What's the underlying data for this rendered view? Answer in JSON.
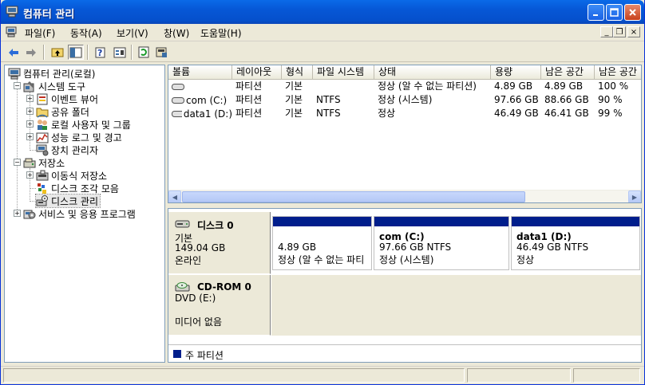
{
  "window": {
    "title": "컴퓨터 관리"
  },
  "menu": {
    "items": [
      "파일(F)",
      "동작(A)",
      "보기(V)",
      "창(W)",
      "도움말(H)"
    ],
    "mdi_min": "_",
    "mdi_restore": "❐",
    "mdi_close": "×"
  },
  "tree": {
    "root": "컴퓨터 관리(로컬)",
    "system_tools": "시스템 도구",
    "event_viewer": "이벤트 뷰어",
    "shared_folders": "공유 폴더",
    "local_users": "로컬 사용자 및 그룹",
    "perf_logs": "성능 로그 및 경고",
    "device_manager": "장치 관리자",
    "storage": "저장소",
    "removable": "이동식 저장소",
    "defrag": "디스크 조각 모음",
    "disk_mgmt": "디스크 관리",
    "services": "서비스 및 응용 프로그램"
  },
  "volumes": {
    "headers": [
      "볼륨",
      "레이아웃",
      "형식",
      "파일 시스템",
      "상태",
      "용량",
      "남은 공간",
      "남은 공간"
    ],
    "rows": [
      [
        "",
        "파티션",
        "기본",
        "",
        "정상 (알 수 없는 파티션)",
        "4.89 GB",
        "4.89 GB",
        "100 %"
      ],
      [
        "com (C:)",
        "파티션",
        "기본",
        "NTFS",
        "정상 (시스템)",
        "97.66 GB",
        "88.66 GB",
        "90 %"
      ],
      [
        "data1 (D:)",
        "파티션",
        "기본",
        "NTFS",
        "정상",
        "46.49 GB",
        "46.41 GB",
        "99 %"
      ]
    ]
  },
  "disks": {
    "disk0": {
      "name": "디스크 0",
      "type": "기본",
      "size": "149.04 GB",
      "status": "온라인",
      "partitions": [
        {
          "name": "",
          "size": "4.89 GB",
          "status": "정상 (알 수 없는 파티"
        },
        {
          "name": "com  (C:)",
          "size": "97.66 GB NTFS",
          "status": "정상 (시스템)"
        },
        {
          "name": "data1  (D:)",
          "size": "46.49 GB NTFS",
          "status": "정상"
        }
      ]
    },
    "cdrom0": {
      "name": "CD-ROM 0",
      "type": "DVD (E:)",
      "status": "미디어 없음"
    },
    "legend": "주 파티션",
    "primary_color": "#001e8c"
  }
}
